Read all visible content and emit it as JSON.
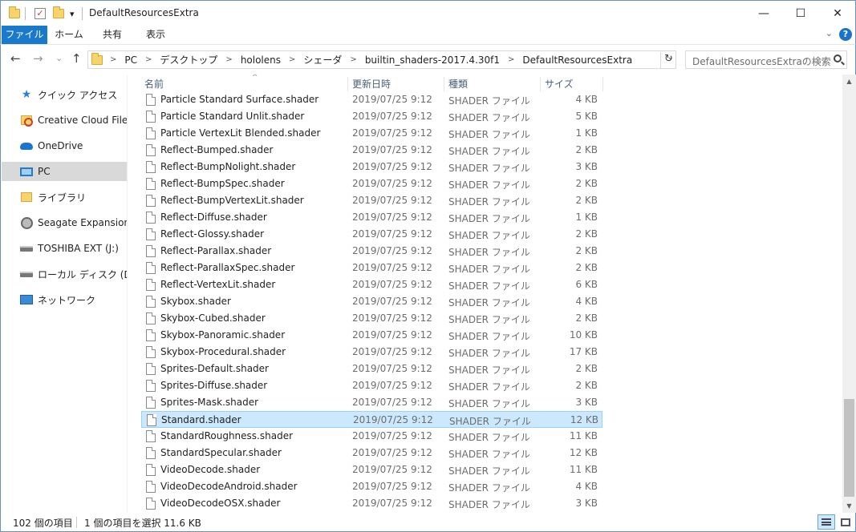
{
  "window": {
    "title": "DefaultResourcesExtra",
    "qa_dropdown": "▾",
    "controls": {
      "minimize": "—",
      "maximize": "☐",
      "close": "✕"
    }
  },
  "ribbon": {
    "tabs": [
      "ファイル",
      "ホーム",
      "共有",
      "表示"
    ],
    "collapse": "⌄",
    "help": "?"
  },
  "nav": {
    "back": "←",
    "forward": "→",
    "recent": "⌄",
    "up": "↑",
    "breadcrumb": [
      "PC",
      "デスクトップ",
      "hololens",
      "シェーダ",
      "builtin_shaders-2017.4.30f1",
      "DefaultResourcesExtra"
    ],
    "crumb_sep": ">",
    "address_dropdown": "⌄",
    "refresh": "↻",
    "search_placeholder": "DefaultResourcesExtraの検索"
  },
  "sidebar": {
    "items": [
      {
        "label": "クイック アクセス",
        "icon": "star-icon"
      },
      {
        "label": "Creative Cloud Files",
        "icon": "creative-cloud-folder-icon"
      },
      {
        "label": "OneDrive",
        "icon": "onedrive-icon"
      },
      {
        "label": "PC",
        "icon": "pc-icon",
        "selected": true
      },
      {
        "label": "ライブラリ",
        "icon": "library-icon"
      },
      {
        "label": "Seagate Expansion Dr",
        "icon": "hard-drive-icon"
      },
      {
        "label": "TOSHIBA EXT (J:)",
        "icon": "drive-icon"
      },
      {
        "label": "ローカル ディスク (D:)",
        "icon": "drive-icon"
      },
      {
        "label": "ネットワーク",
        "icon": "network-icon"
      }
    ]
  },
  "columns": {
    "name": "名前",
    "date": "更新日時",
    "type": "種類",
    "size": "サイズ"
  },
  "files": [
    {
      "name": "Particle Standard Surface.shader",
      "date": "2019/07/25 9:12",
      "type": "SHADER ファイル",
      "size": "4 KB"
    },
    {
      "name": "Particle Standard Unlit.shader",
      "date": "2019/07/25 9:12",
      "type": "SHADER ファイル",
      "size": "5 KB"
    },
    {
      "name": "Particle VertexLit Blended.shader",
      "date": "2019/07/25 9:12",
      "type": "SHADER ファイル",
      "size": "1 KB"
    },
    {
      "name": "Reflect-Bumped.shader",
      "date": "2019/07/25 9:12",
      "type": "SHADER ファイル",
      "size": "2 KB"
    },
    {
      "name": "Reflect-BumpNolight.shader",
      "date": "2019/07/25 9:12",
      "type": "SHADER ファイル",
      "size": "3 KB"
    },
    {
      "name": "Reflect-BumpSpec.shader",
      "date": "2019/07/25 9:12",
      "type": "SHADER ファイル",
      "size": "2 KB"
    },
    {
      "name": "Reflect-BumpVertexLit.shader",
      "date": "2019/07/25 9:12",
      "type": "SHADER ファイル",
      "size": "2 KB"
    },
    {
      "name": "Reflect-Diffuse.shader",
      "date": "2019/07/25 9:12",
      "type": "SHADER ファイル",
      "size": "1 KB"
    },
    {
      "name": "Reflect-Glossy.shader",
      "date": "2019/07/25 9:12",
      "type": "SHADER ファイル",
      "size": "2 KB"
    },
    {
      "name": "Reflect-Parallax.shader",
      "date": "2019/07/25 9:12",
      "type": "SHADER ファイル",
      "size": "2 KB"
    },
    {
      "name": "Reflect-ParallaxSpec.shader",
      "date": "2019/07/25 9:12",
      "type": "SHADER ファイル",
      "size": "2 KB"
    },
    {
      "name": "Reflect-VertexLit.shader",
      "date": "2019/07/25 9:12",
      "type": "SHADER ファイル",
      "size": "6 KB"
    },
    {
      "name": "Skybox.shader",
      "date": "2019/07/25 9:12",
      "type": "SHADER ファイル",
      "size": "4 KB"
    },
    {
      "name": "Skybox-Cubed.shader",
      "date": "2019/07/25 9:12",
      "type": "SHADER ファイル",
      "size": "2 KB"
    },
    {
      "name": "Skybox-Panoramic.shader",
      "date": "2019/07/25 9:12",
      "type": "SHADER ファイル",
      "size": "10 KB"
    },
    {
      "name": "Skybox-Procedural.shader",
      "date": "2019/07/25 9:12",
      "type": "SHADER ファイル",
      "size": "17 KB"
    },
    {
      "name": "Sprites-Default.shader",
      "date": "2019/07/25 9:12",
      "type": "SHADER ファイル",
      "size": "2 KB"
    },
    {
      "name": "Sprites-Diffuse.shader",
      "date": "2019/07/25 9:12",
      "type": "SHADER ファイル",
      "size": "2 KB"
    },
    {
      "name": "Sprites-Mask.shader",
      "date": "2019/07/25 9:12",
      "type": "SHADER ファイル",
      "size": "3 KB"
    },
    {
      "name": "Standard.shader",
      "date": "2019/07/25 9:12",
      "type": "SHADER ファイル",
      "size": "12 KB",
      "selected": true
    },
    {
      "name": "StandardRoughness.shader",
      "date": "2019/07/25 9:12",
      "type": "SHADER ファイル",
      "size": "11 KB"
    },
    {
      "name": "StandardSpecular.shader",
      "date": "2019/07/25 9:12",
      "type": "SHADER ファイル",
      "size": "12 KB"
    },
    {
      "name": "VideoDecode.shader",
      "date": "2019/07/25 9:12",
      "type": "SHADER ファイル",
      "size": "11 KB"
    },
    {
      "name": "VideoDecodeAndroid.shader",
      "date": "2019/07/25 9:12",
      "type": "SHADER ファイル",
      "size": "4 KB"
    },
    {
      "name": "VideoDecodeOSX.shader",
      "date": "2019/07/25 9:12",
      "type": "SHADER ファイル",
      "size": "3 KB"
    }
  ],
  "scrollbar": {
    "up": "▲",
    "down": "▼"
  },
  "status": {
    "item_count": "102 個の項目",
    "selection": "1 個の項目を選択  11.6 KB"
  },
  "colors": {
    "accent": "#1979ca",
    "selection": "#cce8ff",
    "selection_border": "#99d1ff"
  }
}
